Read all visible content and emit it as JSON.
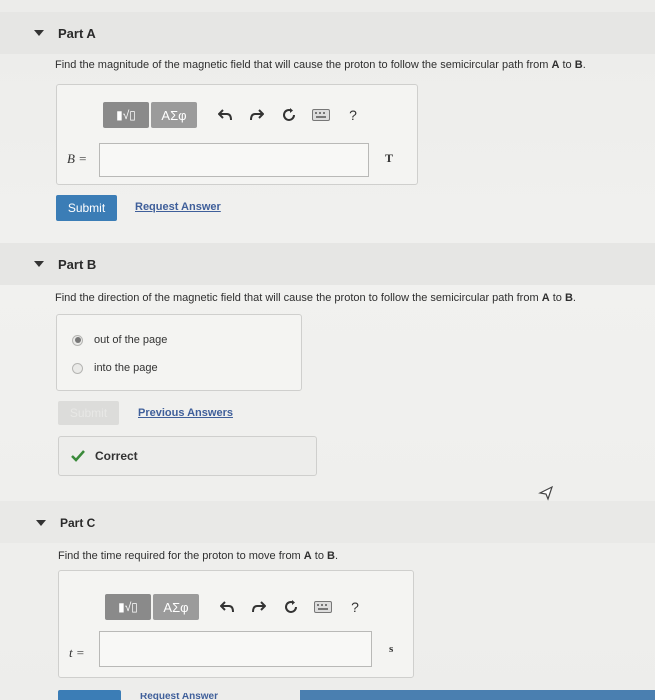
{
  "partA": {
    "title": "Part A",
    "question_prefix": "Find the magnitude of the magnetic field that will cause the proton to follow the semicircular path from ",
    "point_a": "A",
    "question_mid": " to ",
    "point_b": "B",
    "question_suffix": ".",
    "variable": "B =",
    "unit": "T",
    "input_value": "",
    "submit_label": "Submit",
    "request_label": "Request Answer",
    "toolbar": {
      "templates_label": "▮√▯",
      "greek_label": "ΑΣφ",
      "help_label": "?"
    }
  },
  "partB": {
    "title": "Part B",
    "question_prefix": "Find the direction of the magnetic field that will cause the proton to follow the semicircular path from ",
    "point_a": "A",
    "question_mid": " to ",
    "point_b": "B",
    "question_suffix": ".",
    "options": [
      {
        "label": "out of the page",
        "selected": true
      },
      {
        "label": "into the page",
        "selected": false
      }
    ],
    "submit_label": "Submit",
    "previous_label": "Previous Answers",
    "correct_label": "Correct"
  },
  "partC": {
    "title": "Part C",
    "question_prefix": "Find the time required for the proton to move from ",
    "point_a": "A",
    "question_mid": " to ",
    "point_b": "B",
    "question_suffix": ".",
    "variable": "t =",
    "unit": "s",
    "input_value": "",
    "request_label": "Request Answer",
    "toolbar": {
      "templates_label": "▮√▯",
      "greek_label": "ΑΣφ",
      "help_label": "?"
    }
  },
  "colors": {
    "accent": "#3b7db6",
    "link": "#3f5f9a",
    "correct": "#3a8a3a"
  }
}
